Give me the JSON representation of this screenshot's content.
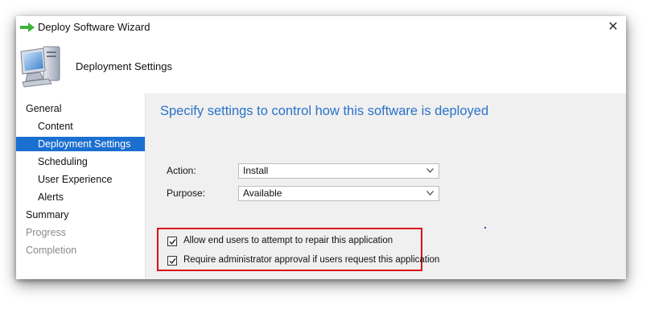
{
  "window": {
    "title": "Deploy Software Wizard",
    "close_label": "✕"
  },
  "banner": {
    "title": "Deployment Settings",
    "icon": "computer-icon"
  },
  "sidebar": {
    "items": [
      {
        "label": "General",
        "level": "top",
        "state": "normal"
      },
      {
        "label": "Content",
        "level": "sub",
        "state": "normal"
      },
      {
        "label": "Deployment Settings",
        "level": "sub",
        "state": "selected"
      },
      {
        "label": "Scheduling",
        "level": "sub",
        "state": "normal"
      },
      {
        "label": "User Experience",
        "level": "sub",
        "state": "normal"
      },
      {
        "label": "Alerts",
        "level": "sub",
        "state": "normal"
      },
      {
        "label": "Summary",
        "level": "top",
        "state": "normal"
      },
      {
        "label": "Progress",
        "level": "top",
        "state": "disabled"
      },
      {
        "label": "Completion",
        "level": "top",
        "state": "disabled"
      }
    ]
  },
  "main": {
    "heading": "Specify settings to control how this software is deployed",
    "action": {
      "label": "Action:",
      "value": "Install"
    },
    "purpose": {
      "label": "Purpose:",
      "value": "Available"
    },
    "checkboxes": [
      {
        "label": "Allow end users to attempt to repair this application",
        "checked": true
      },
      {
        "label": "Require administrator approval if users request this application",
        "checked": true
      }
    ]
  },
  "colors": {
    "accent": "#1b6fd0",
    "heading": "#2a72c9",
    "highlight": "#d8141b",
    "content_bg": "#f0f0f0",
    "title_arrow": "#3cb43c"
  }
}
